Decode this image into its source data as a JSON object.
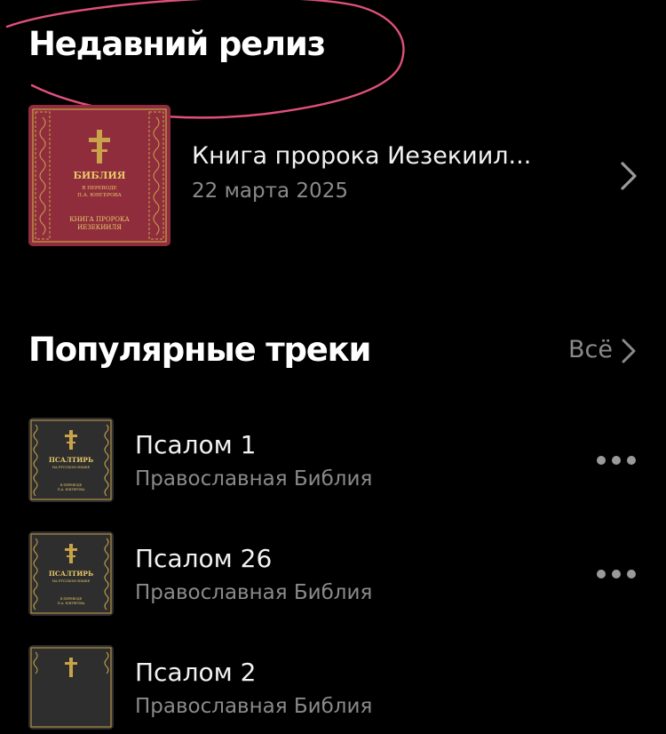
{
  "recent_release": {
    "heading": "Недавний релиз",
    "item": {
      "title": "Книга пророка Иезекиил...",
      "date": "22 марта 2025",
      "cover": {
        "line1": "БИБЛИЯ",
        "line2": "В ПЕРЕВОДЕ",
        "line3": "П.А. ЮНГЕРОВА",
        "line4": "КНИГА ПРОРОКА",
        "line5": "ИЕЗЕКИИЛЯ",
        "color": "#8f2d3c"
      }
    }
  },
  "popular_tracks": {
    "heading": "Популярные треки",
    "see_all_label": "Всё",
    "cover": {
      "line1": "ПСАЛТИРЬ",
      "line2": "НА РУССКОМ ЯЗЫКЕ",
      "line3": "В ПЕРЕВОДЕ",
      "line4": "П.А. ЮНГЕРОВА",
      "color": "#2e2e2e"
    },
    "tracks": [
      {
        "title": "Псалом 1",
        "artist": "Православная Библия"
      },
      {
        "title": "Псалом 26",
        "artist": "Православная Библия"
      },
      {
        "title": "Псалом 2",
        "artist": "Православная Библия"
      }
    ]
  },
  "colors": {
    "background": "#000000",
    "primary_text": "#f2f2f2",
    "secondary_text": "#8a8a8a",
    "annotation_stroke": "#e0507a",
    "ornament_gold": "#c9a24a"
  },
  "icons": {
    "release_chevron": "chevron-right-icon",
    "see_all_chevron": "chevron-right-icon",
    "track_menu": "more-horizontal-icon"
  }
}
